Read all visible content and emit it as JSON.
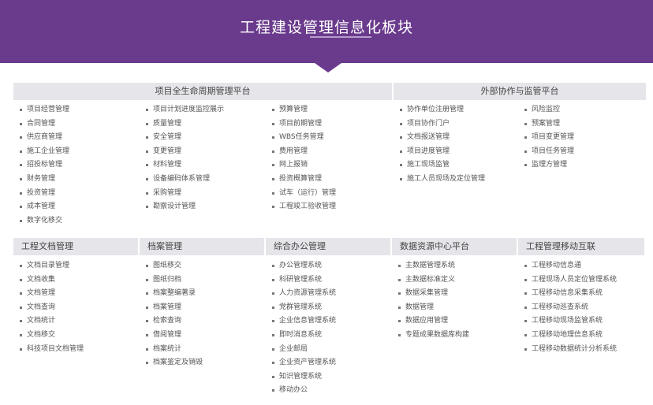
{
  "banner": {
    "title": "工程建设管理信息化板块"
  },
  "panels": {
    "lifecycle": {
      "title": "项目全生命周期管理平台",
      "columns": [
        [
          "项目经营管理",
          "合同管理",
          "供应商管理",
          "施工企业管理",
          "招投标管理",
          "财务管理",
          "投资管理",
          "成本管理",
          "数字化移交"
        ],
        [
          "项目计划进度监控展示",
          "质量管理",
          "安全管理",
          "变更管理",
          "材料管理",
          "设备编码体系管理",
          "采购管理",
          "勘察设计管理"
        ],
        [
          "预算管理",
          "项目前期管理",
          "WBS任务管理",
          "费用管理",
          "网上报销",
          "投资概算管理",
          "试车（运行）管理",
          "工程竣工验收管理"
        ]
      ]
    },
    "external": {
      "title": "外部协作与监管平台",
      "columns": [
        [
          "协作单位注册管理",
          "项目协作门户",
          "文档报送管理",
          "项目进度管理",
          "施工现场监管",
          "施工人员现场及定位管理"
        ],
        [
          "风险监控",
          "预案管理",
          "项目变更管理",
          "项目任务管理",
          "监理方管理"
        ]
      ]
    },
    "bottom": [
      {
        "title": "工程文档管理",
        "items": [
          "文档目录管理",
          "文档收集",
          "文档管理",
          "文档查询",
          "文档统计",
          "文档移交",
          "科技项目文档管理"
        ]
      },
      {
        "title": "档案管理",
        "items": [
          "图纸移交",
          "图纸归档",
          "档案整编著录",
          "档案管理",
          "检索查询",
          "借阅管理",
          "档案统计",
          "档案鉴定及销毁"
        ]
      },
      {
        "title": "综合办公管理",
        "items": [
          "办公管理系统",
          "科研管理系统",
          "人力资源管理系统",
          "党群管理系统",
          "企业信息管理系统",
          "即时消息系统",
          "企业邮局",
          "企业资产管理系统",
          "知识管理系统",
          "移动办公"
        ]
      },
      {
        "title": "数据资源中心平台",
        "items": [
          "主数据管理系统",
          "主数据标准定义",
          "数据采集管理",
          "数据管理",
          "数据应用管理",
          "专题成果数据库构建"
        ]
      },
      {
        "title": "工程管理移动互联",
        "items": [
          "工程移动信息通",
          "工程现场人员定位管理系统",
          "工程移动信息采集系统",
          "工程移动巡查系统",
          "工程移动现场监管系统",
          "工程移动地理信息系统",
          "工程移动数据统计分析系统"
        ]
      }
    ]
  }
}
